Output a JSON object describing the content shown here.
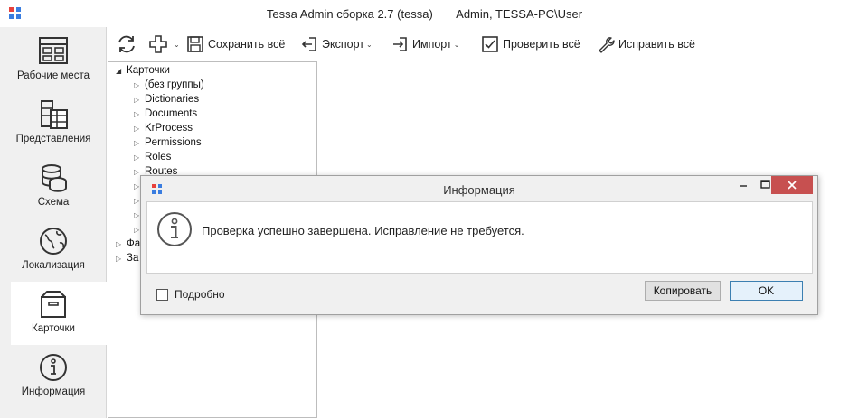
{
  "window": {
    "title": "Tessa Admin сборка 2.7 (tessa)       Admin, TESSA-PC\\User",
    "logo_colors": [
      "#e8413c",
      "#3a7de0",
      "#3a7de0",
      "#3a7de0"
    ]
  },
  "sidebar": {
    "items": [
      {
        "label": "Рабочие места",
        "icon": "workplaces-icon"
      },
      {
        "label": "Представления",
        "icon": "views-icon"
      },
      {
        "label": "Схема",
        "icon": "database-icon"
      },
      {
        "label": "Локализация",
        "icon": "globe-icon"
      },
      {
        "label": "Карточки",
        "icon": "box-icon",
        "active": true
      },
      {
        "label": "Информация",
        "icon": "info-icon"
      }
    ]
  },
  "toolbar": {
    "refresh_icon": "refresh-icon",
    "add_icon": "plus-icon",
    "save_all": "Сохранить всё",
    "export": "Экспорт",
    "import": "Импорт",
    "check_all": "Проверить всё",
    "fix_all": "Исправить всё"
  },
  "tree": {
    "root": "Карточки",
    "children": [
      "(без группы)",
      "Dictionaries",
      "Documents",
      "KrProcess",
      "Permissions",
      "Roles",
      "Routes"
    ],
    "siblings": [
      "Фа",
      "За"
    ]
  },
  "dialog": {
    "title": "Информация",
    "message": "Проверка успешно завершена. Исправление не требуется.",
    "details_label": "Подробно",
    "details_checked": false,
    "copy_button": "Копировать",
    "ok_button": "OK",
    "close_color": "#c75050"
  }
}
